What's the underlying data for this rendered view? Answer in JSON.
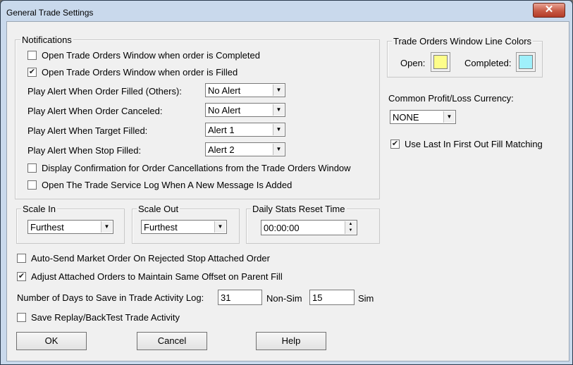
{
  "window": {
    "title": "General Trade Settings",
    "close_glyph": "✕"
  },
  "notifications": {
    "title": "Notifications",
    "checks": [
      {
        "label": "Open Trade Orders Window when order is Completed",
        "checked": false
      },
      {
        "label": "Open Trade Orders Window when order is Filled",
        "checked": true
      }
    ],
    "alerts": [
      {
        "label": "Play Alert When Order Filled (Others):",
        "value": "No Alert"
      },
      {
        "label": "Play Alert When Order Canceled:",
        "value": "No Alert"
      },
      {
        "label": "Play Alert When Target Filled:",
        "value": "Alert 1"
      },
      {
        "label": "Play Alert When Stop Filled:",
        "value": "Alert 2"
      }
    ],
    "checks2": [
      {
        "label": "Display Confirmation for Order Cancellations from the Trade Orders Window",
        "checked": false
      },
      {
        "label": "Open The Trade Service Log When A New Message Is Added",
        "checked": false
      }
    ]
  },
  "line_colors": {
    "title": "Trade Orders Window Line Colors",
    "open_label": "Open:",
    "open_color": "#fdfd8a",
    "completed_label": "Completed:",
    "completed_color": "#9ff0fb"
  },
  "currency": {
    "label": "Common Profit/Loss Currency:",
    "value": "NONE"
  },
  "lifo": {
    "label": "Use Last In First Out Fill Matching",
    "checked": true
  },
  "scale_in": {
    "title": "Scale In",
    "value": "Furthest"
  },
  "scale_out": {
    "title": "Scale Out",
    "value": "Furthest"
  },
  "daily_reset": {
    "title": "Daily Stats Reset Time",
    "value": "00:00:00"
  },
  "options": [
    {
      "label": "Auto-Send Market Order On Rejected Stop Attached Order",
      "checked": false
    },
    {
      "label": "Adjust Attached Orders to Maintain Same Offset on Parent Fill",
      "checked": true
    }
  ],
  "days": {
    "label": "Number of Days to Save in Trade Activity Log:",
    "nonsim_value": "31",
    "nonsim_label": "Non-Sim",
    "sim_value": "15",
    "sim_label": "Sim"
  },
  "replay": {
    "label": "Save Replay/BackTest Trade Activity",
    "checked": false
  },
  "buttons": {
    "ok": "OK",
    "cancel": "Cancel",
    "help": "Help"
  },
  "glyphs": {
    "check": "✔",
    "arrow": "▼",
    "spin_up": "▲",
    "spin_down": "▼"
  }
}
